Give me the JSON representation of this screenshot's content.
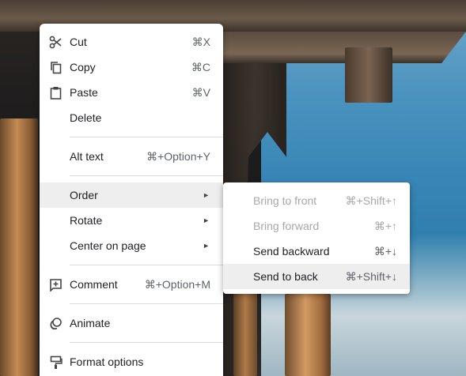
{
  "menu": {
    "items": [
      {
        "label": "Cut",
        "shortcut": "⌘X",
        "icon": "scissors-icon"
      },
      {
        "label": "Copy",
        "shortcut": "⌘C",
        "icon": "copy-icon"
      },
      {
        "label": "Paste",
        "shortcut": "⌘V",
        "icon": "clipboard-icon"
      },
      {
        "label": "Delete",
        "shortcut": ""
      },
      {
        "label": "Alt text",
        "shortcut": "⌘+Option+Y"
      },
      {
        "label": "Order",
        "submenu": true
      },
      {
        "label": "Rotate",
        "submenu": true
      },
      {
        "label": "Center on page",
        "submenu": true
      },
      {
        "label": "Comment",
        "shortcut": "⌘+Option+M",
        "icon": "add-comment-icon"
      },
      {
        "label": "Animate",
        "shortcut": "",
        "icon": "animate-icon"
      },
      {
        "label": "Format options",
        "shortcut": "",
        "icon": "format-paint-icon"
      }
    ],
    "submenu_arrow": "►"
  },
  "order_submenu": {
    "items": [
      {
        "label": "Bring to front",
        "shortcut": "⌘+Shift+↑",
        "enabled": false
      },
      {
        "label": "Bring forward",
        "shortcut": "⌘+↑",
        "enabled": false
      },
      {
        "label": "Send backward",
        "shortcut": "⌘+↓",
        "enabled": true
      },
      {
        "label": "Send to back",
        "shortcut": "⌘+Shift+↓",
        "enabled": true
      }
    ]
  },
  "colors": {
    "menu_bg": "#ffffff",
    "hover_bg": "#eeeeee",
    "text": "#202124",
    "disabled_text": "#a8a8a8",
    "separator": "#dadce0"
  }
}
